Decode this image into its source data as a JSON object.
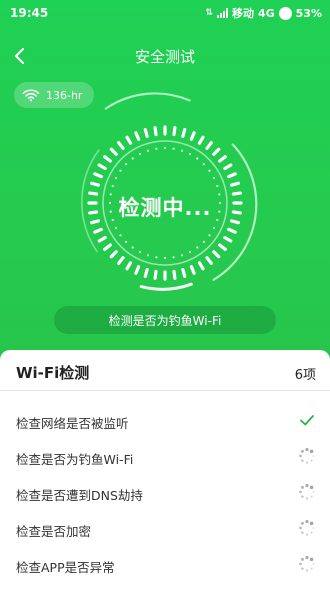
{
  "status_bar": {
    "time": "19:45",
    "carrier": "移动",
    "network": "4G",
    "battery": "53%"
  },
  "header": {
    "title": "安全测试"
  },
  "wifi_chip": {
    "ssid": "136-hr"
  },
  "scan": {
    "main_text": "检测中...",
    "current_check": "检测是否为钓鱼Wi-Fi"
  },
  "panel": {
    "title": "Wi-Fi检测",
    "count": "6项",
    "items": [
      {
        "label": "检查网络是否被监听",
        "status": "done"
      },
      {
        "label": "检查是否为钓鱼Wi-Fi",
        "status": "loading"
      },
      {
        "label": "检查是否遭到DNS劫持",
        "status": "loading"
      },
      {
        "label": "检查是否加密",
        "status": "loading"
      },
      {
        "label": "检查APP是否异常",
        "status": "loading"
      }
    ]
  },
  "colors": {
    "primary_green": "#22c24d",
    "check_green": "#2bb24c"
  }
}
